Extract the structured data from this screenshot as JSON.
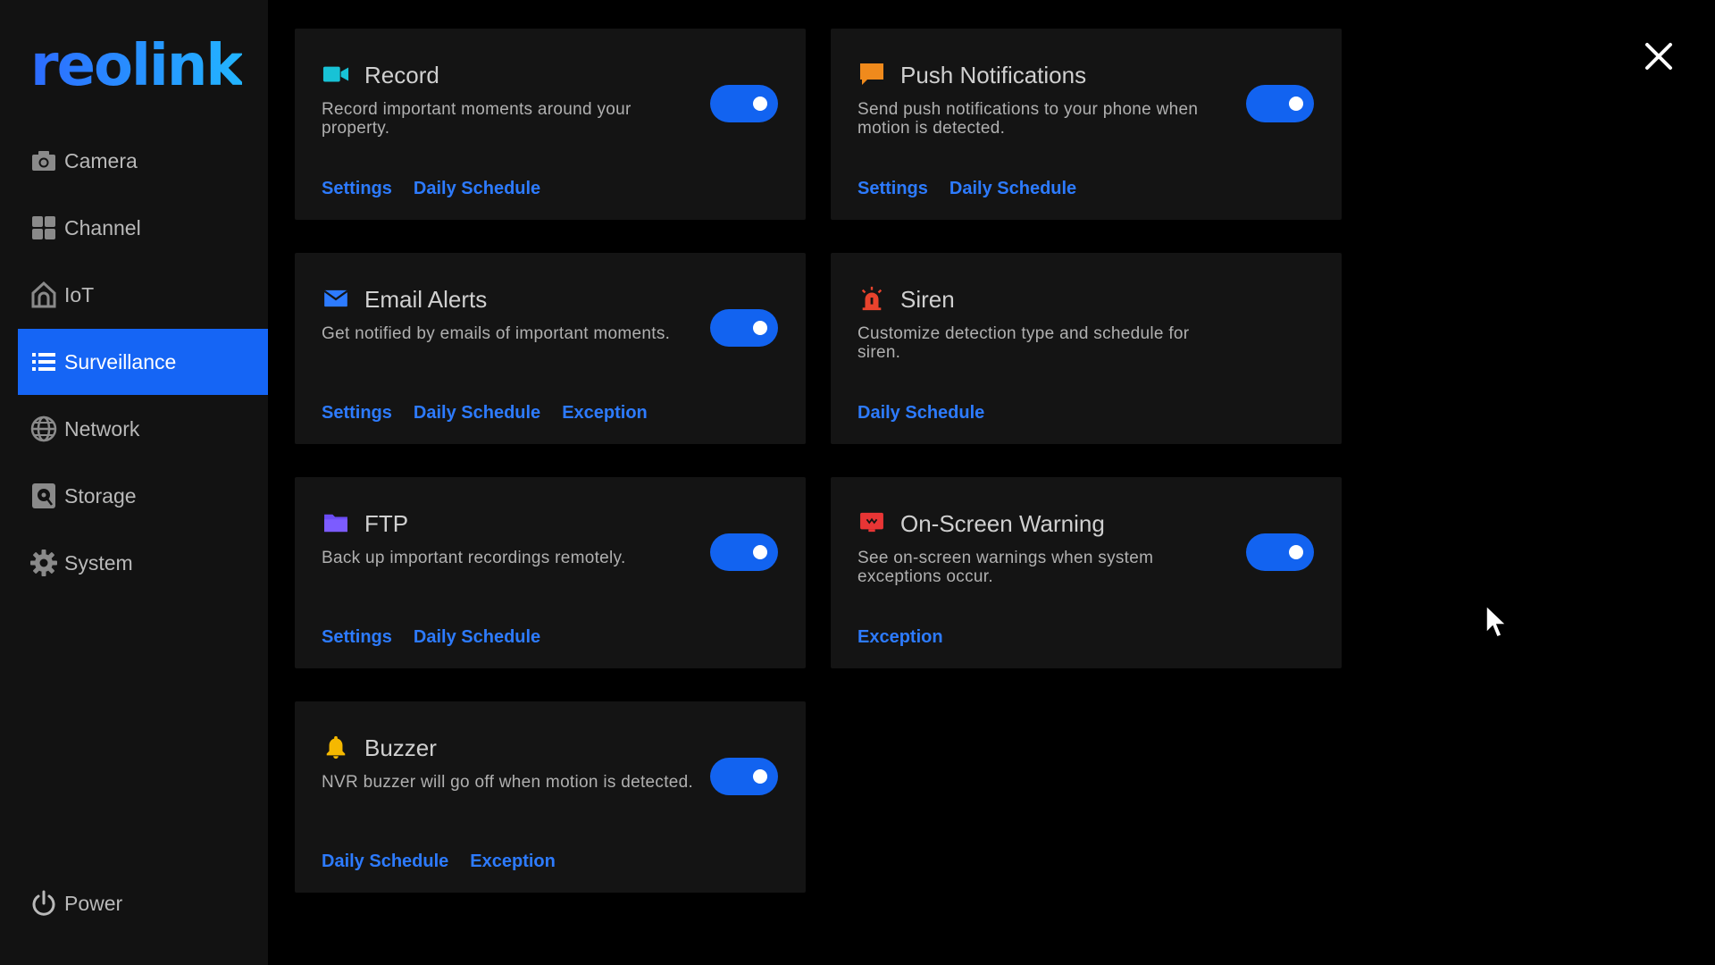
{
  "app": {
    "logo_text": "reolink",
    "accent_color": "#1565f5",
    "link_color": "#2d7bff"
  },
  "sidebar": {
    "items": [
      {
        "label": "Camera",
        "icon": "camera-icon",
        "active": false
      },
      {
        "label": "Channel",
        "icon": "channel-grid-icon",
        "active": false
      },
      {
        "label": "IoT",
        "icon": "iot-home-icon",
        "active": false
      },
      {
        "label": "Surveillance",
        "icon": "list-icon",
        "active": true
      },
      {
        "label": "Network",
        "icon": "globe-icon",
        "active": false
      },
      {
        "label": "Storage",
        "icon": "storage-icon",
        "active": false
      },
      {
        "label": "System",
        "icon": "gear-icon",
        "active": false
      }
    ],
    "power_label": "Power"
  },
  "cards": [
    {
      "title": "Record",
      "icon": "video-camera-icon",
      "description": "Record important moments around your property.",
      "toggle": true,
      "links": [
        "Settings",
        "Daily Schedule"
      ]
    },
    {
      "title": "Push Notifications",
      "icon": "chat-bubble-icon",
      "description": "Send push notifications to your phone when motion is detected.",
      "toggle": true,
      "links": [
        "Settings",
        "Daily Schedule"
      ]
    },
    {
      "title": "Email Alerts",
      "icon": "envelope-icon",
      "description": "Get notified by emails of important moments.",
      "toggle": true,
      "links": [
        "Settings",
        "Daily Schedule",
        "Exception"
      ]
    },
    {
      "title": "Siren",
      "icon": "siren-icon",
      "description": "Customize detection type and schedule for siren.",
      "toggle": false,
      "links": [
        "Daily Schedule"
      ]
    },
    {
      "title": "FTP",
      "icon": "folder-icon",
      "description": "Back up important recordings remotely.",
      "toggle": true,
      "links": [
        "Settings",
        "Daily Schedule"
      ]
    },
    {
      "title": "On-Screen Warning",
      "icon": "warning-screen-icon",
      "description": "See on-screen warnings when system exceptions occur.",
      "toggle": true,
      "links": [
        "Exception"
      ]
    },
    {
      "title": "Buzzer",
      "icon": "bell-icon",
      "description": "NVR buzzer will go off when motion is detected.",
      "toggle": true,
      "links": [
        "Daily Schedule",
        "Exception"
      ]
    }
  ]
}
